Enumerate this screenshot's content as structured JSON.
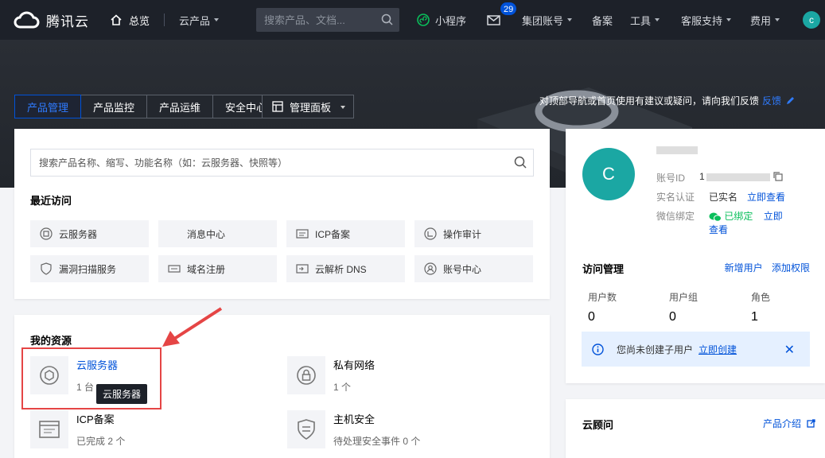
{
  "topbar": {
    "brand": "腾讯云",
    "home": "总览",
    "products": "云产品",
    "search_placeholder": "搜索产品、文档...",
    "mini_program": "小程序",
    "mail_badge": "29",
    "group_account": "集团账号",
    "filing": "备案",
    "tools": "工具",
    "support": "客服支持",
    "billing": "费用",
    "avatar_letter": "c"
  },
  "banner": {
    "tabs": [
      "产品管理",
      "产品监控",
      "产品运维",
      "安全中心"
    ],
    "panel_label": "管理面板",
    "feedback_text": "对顶部导航或首页使用有建议或疑问，请向我们反馈",
    "feedback_link": "反馈"
  },
  "search_card": {
    "placeholder": "搜索产品名称、缩写、功能名称（如：云服务器、快照等）",
    "recent_title": "最近访问",
    "recent": [
      {
        "label": "云服务器",
        "icon": "cvm-icon"
      },
      {
        "label": "消息中心",
        "icon": "message-icon"
      },
      {
        "label": "ICP备案",
        "icon": "icp-icon"
      },
      {
        "label": "操作审计",
        "icon": "audit-icon"
      },
      {
        "label": "漏洞扫描服务",
        "icon": "shield-icon"
      },
      {
        "label": "域名注册",
        "icon": "domain-icon"
      },
      {
        "label": "云解析 DNS",
        "icon": "dns-icon"
      },
      {
        "label": "账号中心",
        "icon": "account-icon"
      }
    ]
  },
  "resources": {
    "title": "我的资源",
    "items": [
      {
        "name": "云服务器",
        "count": "1 台"
      },
      {
        "name": "私有网络",
        "count": "1 个"
      },
      {
        "name": "ICP备案",
        "count": "已完成 2 个"
      },
      {
        "name": "主机安全",
        "count": "待处理安全事件 0 个"
      }
    ],
    "tooltip": "云服务器"
  },
  "account": {
    "avatar_letter": "C",
    "id_label": "账号ID",
    "id_value": "1",
    "realname_label": "实名认证",
    "realname_status": "已实名",
    "realname_link": "立即查看",
    "wechat_label": "微信绑定",
    "wechat_status": "已绑定",
    "wechat_link": "立即查看",
    "access_title": "访问管理",
    "add_user": "新增用户",
    "add_permission": "添加权限",
    "stats": [
      {
        "label": "用户数",
        "value": "0"
      },
      {
        "label": "用户组",
        "value": "0"
      },
      {
        "label": "角色",
        "value": "1"
      }
    ],
    "notice_text": "您尚未创建子用户",
    "notice_link": "立即创建"
  },
  "advisor": {
    "title": "云顾问",
    "link": "产品介绍"
  },
  "colors": {
    "accent": "#0052d9",
    "topbar": "#1d2129",
    "avatar": "#1ba7a3",
    "success": "#0abf5b",
    "highlight": "#e54545"
  }
}
